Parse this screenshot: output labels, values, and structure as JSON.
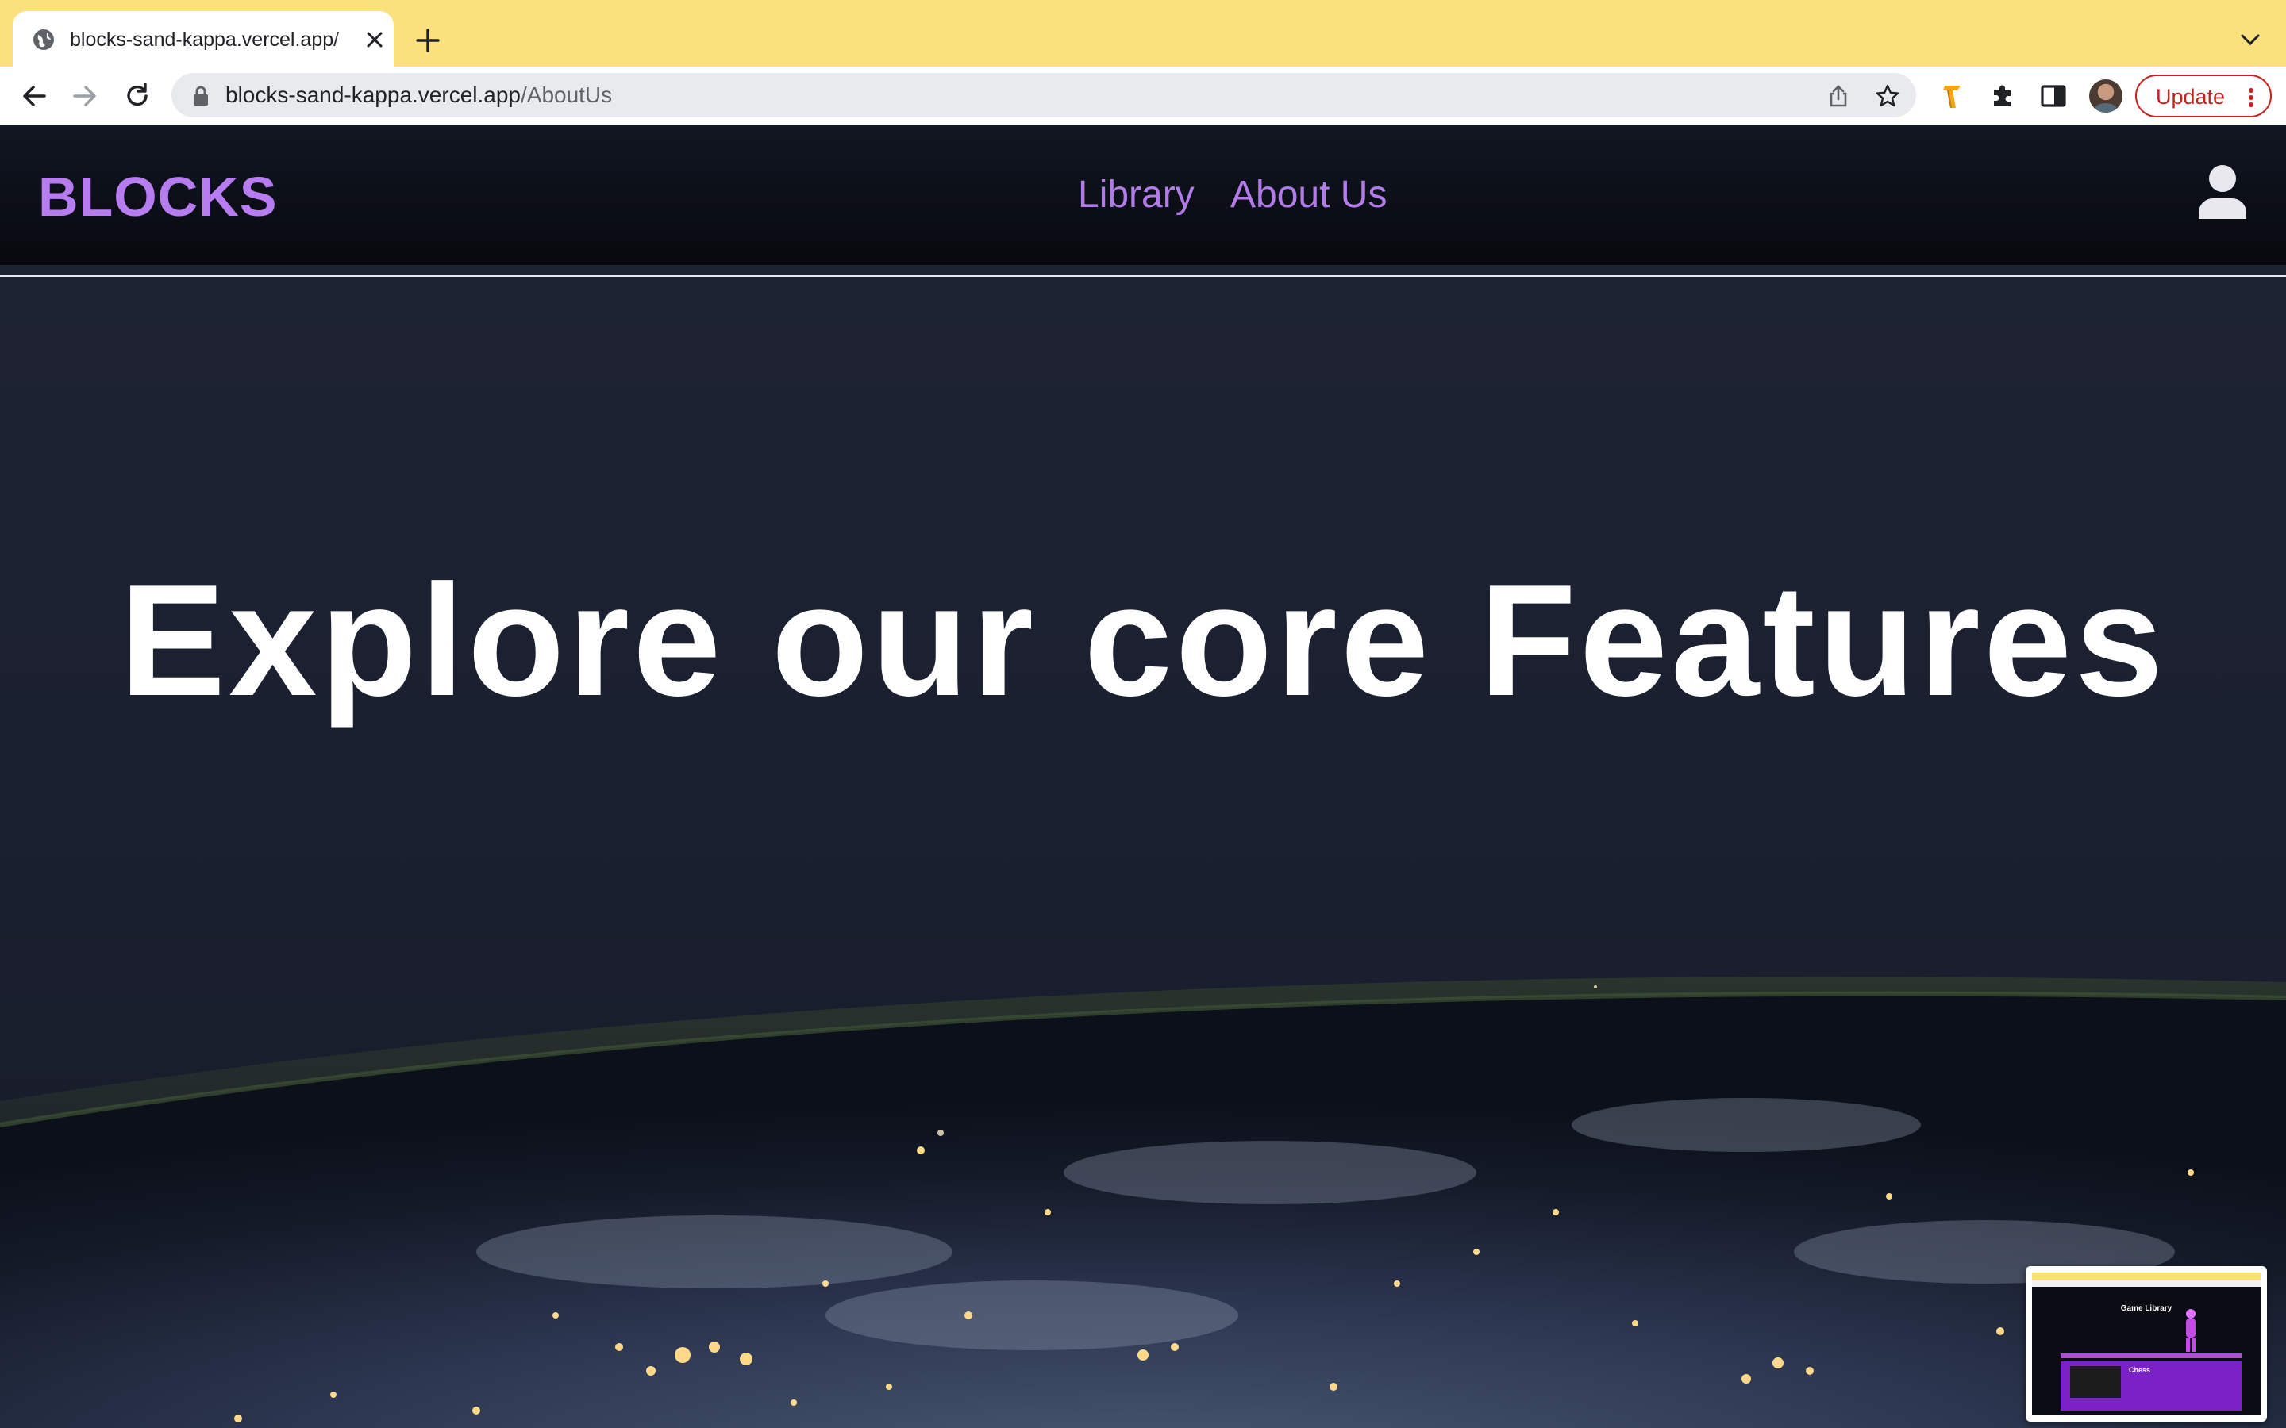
{
  "browser": {
    "tab_title": "blocks-sand-kappa.vercel.app/",
    "url_host": "blocks-sand-kappa.vercel.app",
    "url_path": "/AboutUs",
    "update_label": "Update",
    "icons": [
      "globe-icon",
      "close-icon",
      "plus-icon",
      "chevron-down-icon",
      "back-arrow-icon",
      "forward-arrow-icon",
      "reload-icon",
      "lock-icon",
      "share-icon",
      "star-icon",
      "key-extension-icon",
      "puzzle-extension-icon",
      "side-panel-icon",
      "more-vert-icon"
    ]
  },
  "site": {
    "logo": "BLOCKS",
    "nav": [
      "Library",
      "About Us"
    ],
    "hero_title": "Explore our core Features",
    "colors": {
      "accent": "#b67cf0",
      "header_bg": "#07090e",
      "page_bg": "#1c2131",
      "text": "#ffffff"
    }
  },
  "pip": {
    "title": "Game Library",
    "card_title": "Chess"
  }
}
